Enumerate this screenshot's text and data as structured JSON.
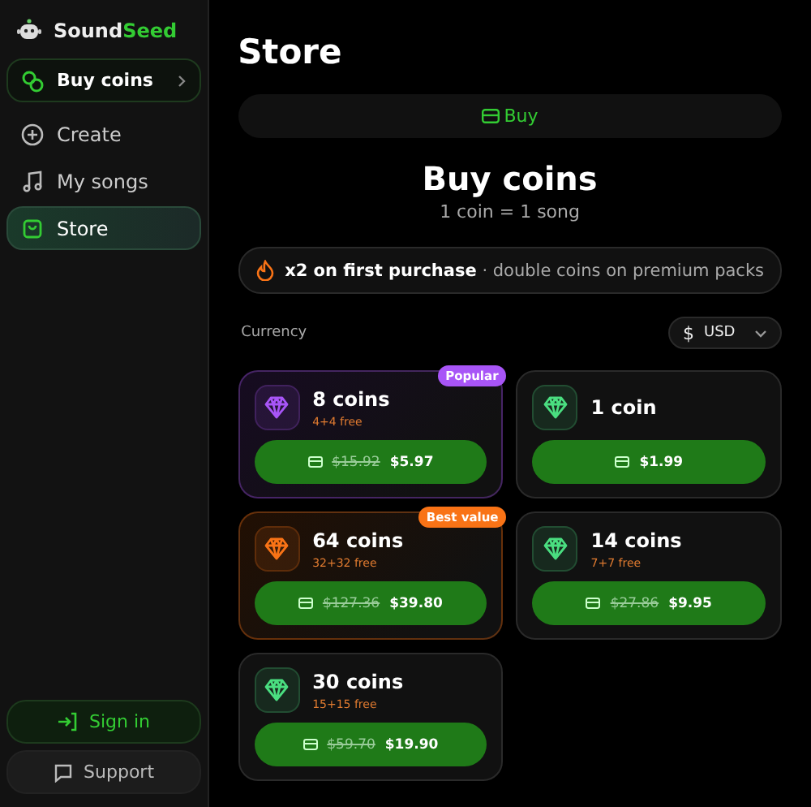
{
  "brand": {
    "name": "Sound",
    "accent": "Seed"
  },
  "nav": [
    {
      "kind": "coins",
      "label": "Buy coins",
      "selected": false
    },
    {
      "kind": "create",
      "label": "Create",
      "selected": false
    },
    {
      "kind": "songs",
      "label": "My songs",
      "selected": false
    },
    {
      "kind": "store",
      "label": "Store",
      "selected": true
    }
  ],
  "footer": [
    {
      "kind": "signin",
      "label": "Sign in"
    },
    {
      "kind": "support",
      "label": "Support"
    }
  ],
  "page_title": "Store",
  "tab": {
    "label": "Buy",
    "selected": true
  },
  "title": "Buy coins",
  "subtitle": "1 coin = 1 song",
  "promo": {
    "bold": "x2 on first purchase",
    "rest": " · double coins on premium packs"
  },
  "currency": {
    "label": "Currency",
    "symbol": "$",
    "value": "USD"
  },
  "packs": [
    {
      "name": "8 coins",
      "bonus": "4+4 free",
      "badge": "Popular",
      "color": "#a855f7",
      "old_price": "$15.92",
      "price": "$5.97"
    },
    {
      "name": "1 coin",
      "color": "#4ade80",
      "price": "$1.99"
    },
    {
      "name": "64 coins",
      "bonus": "32+32 free",
      "badge": "Best value",
      "color": "#f97316",
      "old_price": "$127.36",
      "price": "$39.80"
    },
    {
      "name": "14 coins",
      "bonus": "7+7 free",
      "color": "#4ade80",
      "old_price": "$27.86",
      "price": "$9.95"
    },
    {
      "name": "30 coins",
      "bonus": "15+15 free",
      "color": "#4ade80",
      "old_price": "$59.70",
      "price": "$19.90"
    }
  ]
}
